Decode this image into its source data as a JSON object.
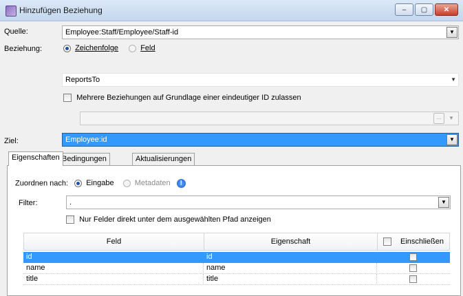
{
  "window": {
    "title": "Hinzufügen Beziehung",
    "icon": "app-icon",
    "controls": {
      "minimize": "‒",
      "maximize": "▢",
      "close": "✕"
    }
  },
  "source": {
    "label": "Quelle:",
    "value": "Employee:Staff/Employee/Staff-id"
  },
  "relation": {
    "label": "Beziehung:",
    "option_string": "Zeichenfolge",
    "option_field": "Feld",
    "selected": "Zeichenfolge",
    "value": "ReportsTo",
    "multi_checkbox_label": "Mehrere Beziehungen auf Grundlage einer eindeutiger ID zulassen",
    "multi_checked": false,
    "disabled_field_value": "",
    "ellipsis": "..."
  },
  "target": {
    "label": "Ziel:",
    "value": "Employee:id"
  },
  "tabs": [
    {
      "label": "Eigenschaften",
      "active": true
    },
    {
      "label": "Bedingungen",
      "active": false
    },
    {
      "label": "Aktualisierungen",
      "active": false
    }
  ],
  "properties": {
    "map_label": "Zuordnen nach:",
    "map_option_input": "Eingabe",
    "map_option_metadata": "Metadaten",
    "map_selected": "Eingabe",
    "filter_label": "Filter:",
    "filter_value": ".",
    "direct_only_label": "Nur Felder direkt unter dem ausgewählten Pfad anzeigen",
    "direct_only_checked": false
  },
  "grid": {
    "columns": [
      "Feld",
      "Eigenschaft",
      "Einschließen"
    ],
    "rows": [
      {
        "field": "id",
        "property": "id",
        "include": false,
        "selected": true
      },
      {
        "field": "name",
        "property": "name",
        "include": false,
        "selected": false
      },
      {
        "field": "title",
        "property": "title",
        "include": false,
        "selected": false
      }
    ]
  },
  "colors": {
    "selection": "#3399ff",
    "accent": "#1d4fa6"
  }
}
